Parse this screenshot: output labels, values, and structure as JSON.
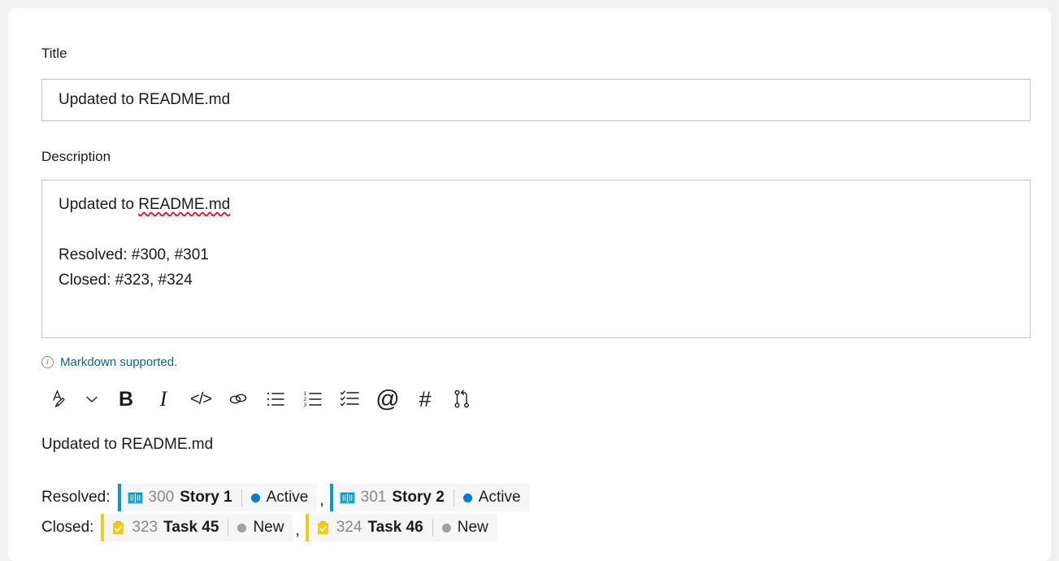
{
  "form": {
    "title_label": "Title",
    "title_value": "Updated to README.md",
    "description_label": "Description",
    "description_value": "Updated to README.md\n\nResolved: #300, #301\nClosed: #323, #324",
    "description_line1_prefix": "Updated to ",
    "description_line1_spelled": "README.md",
    "description_rest": "\n\nResolved: #300, #301\nClosed: #323, #324",
    "markdown_note": "Markdown supported.",
    "markdown_note_color": "#0b62a4",
    "info_icon": "info-icon"
  },
  "toolbar": {
    "buttons": [
      {
        "name": "text-style-icon",
        "label": "A"
      },
      {
        "name": "chevron-down-icon",
        "label": "v"
      },
      {
        "name": "bold-icon",
        "label": "B"
      },
      {
        "name": "italic-icon",
        "label": "I"
      },
      {
        "name": "code-icon",
        "label": "</>"
      },
      {
        "name": "link-icon",
        "label": "link"
      },
      {
        "name": "bulleted-list-icon",
        "label": "bullets"
      },
      {
        "name": "numbered-list-icon",
        "label": "numbers"
      },
      {
        "name": "checklist-icon",
        "label": "checklist"
      },
      {
        "name": "mention-icon",
        "label": "@"
      },
      {
        "name": "work-item-hash-icon",
        "label": "#"
      },
      {
        "name": "pull-request-icon",
        "label": "pr"
      }
    ]
  },
  "preview": {
    "heading": "Updated to README.md",
    "rows": [
      {
        "label": "Resolved:",
        "separator": ",",
        "items": [
          {
            "id": "300",
            "title": "Story 1",
            "state": "Active",
            "state_color": "#0078d4",
            "type": "user-story",
            "accent": "#009ccc"
          },
          {
            "id": "301",
            "title": "Story 2",
            "state": "Active",
            "state_color": "#0078d4",
            "type": "user-story",
            "accent": "#009ccc"
          }
        ]
      },
      {
        "label": "Closed:",
        "separator": ",",
        "items": [
          {
            "id": "323",
            "title": "Task 45",
            "state": "New",
            "state_color": "#a0a0a0",
            "type": "task",
            "accent": "#f2cb1d"
          },
          {
            "id": "324",
            "title": "Task 46",
            "state": "New",
            "state_color": "#a0a0a0",
            "type": "task",
            "accent": "#f2cb1d"
          }
        ]
      }
    ]
  }
}
